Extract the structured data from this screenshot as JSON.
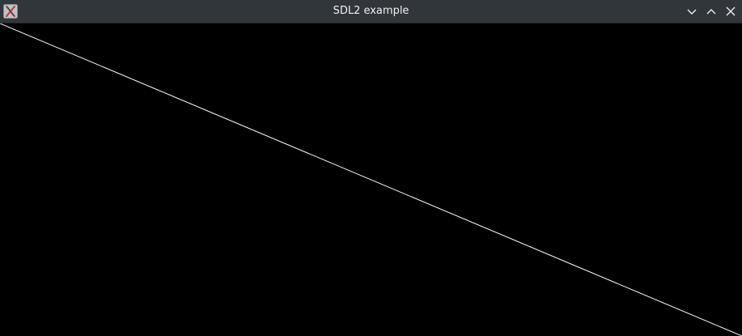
{
  "window": {
    "title": "SDL2 example"
  },
  "icons": {
    "app": "x11-app-icon",
    "minimize": "chevron-down-icon",
    "maximize": "chevron-up-icon",
    "close": "close-icon"
  },
  "colors": {
    "titlebar": "#31363b",
    "title_text": "#eff0f1",
    "canvas_background": "#000000",
    "line": "#ffffff"
  }
}
